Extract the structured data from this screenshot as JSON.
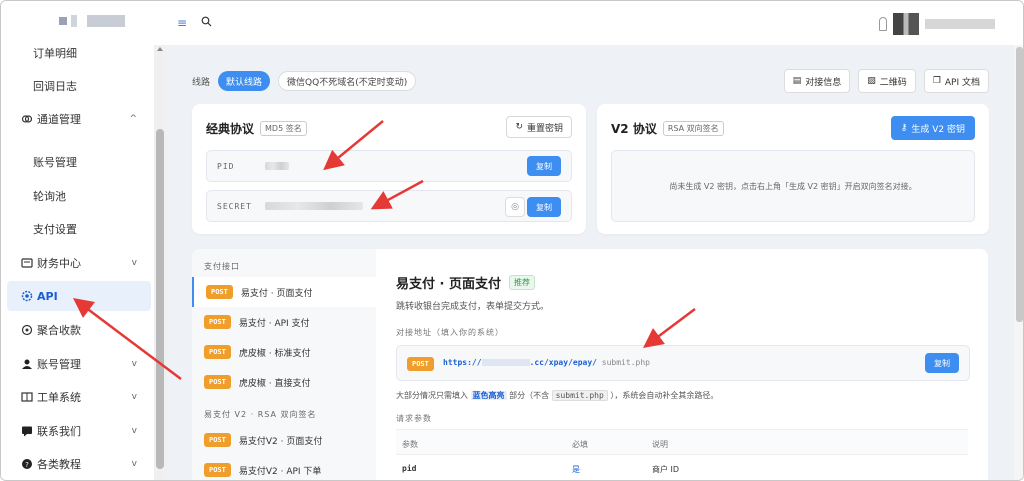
{
  "sidebar": {
    "items": [
      {
        "label": "订单明细",
        "type": "sub"
      },
      {
        "label": "回调日志",
        "type": "sub"
      },
      {
        "label": "通道管理",
        "type": "group",
        "icon": "link-icon",
        "expanded": true
      },
      {
        "label": "账号管理",
        "type": "sub"
      },
      {
        "label": "轮询池",
        "type": "sub"
      },
      {
        "label": "支付设置",
        "type": "sub"
      },
      {
        "label": "财务中心",
        "type": "group",
        "icon": "wallet-icon"
      },
      {
        "label": "API",
        "type": "group",
        "icon": "gear-icon",
        "active": true
      },
      {
        "label": "聚合收款",
        "type": "group",
        "icon": "collect-icon"
      },
      {
        "label": "账号管理",
        "type": "group",
        "icon": "user-icon"
      },
      {
        "label": "工单系统",
        "type": "group",
        "icon": "book-icon"
      },
      {
        "label": "联系我们",
        "type": "group",
        "icon": "chat-icon"
      },
      {
        "label": "各类教程",
        "type": "group",
        "icon": "help-icon"
      }
    ]
  },
  "route": {
    "label": "线路",
    "options": [
      "默认线路",
      "微信QQ不死域名(不定时变动)"
    ]
  },
  "top_actions": [
    "对接信息",
    "二维码",
    "API 文档"
  ],
  "classic": {
    "title": "经典协议",
    "tag": "MD5 签名",
    "reset_label": "重置密钥",
    "pid_label": "PID",
    "secret_label": "SECRET",
    "copy_label": "复制"
  },
  "v2": {
    "title": "V2 协议",
    "tag": "RSA 双向签名",
    "gen_label": "生成 V2 密钥",
    "empty_text": "尚未生成 V2 密钥，点击右上角「生成 V2 密钥」开启双向签名对接。"
  },
  "api_list": {
    "section1": "支付接口",
    "section2": "易支付 V2 · RSA 双向签名",
    "method": "POST",
    "items": [
      "易支付 · 页面支付",
      "易支付 · API 支付",
      "虎皮椒 · 标准支付",
      "虎皮椒 · 直接支付"
    ],
    "items_v2": [
      "易支付V2 · 页面支付",
      "易支付V2 · API 下单"
    ]
  },
  "detail": {
    "title": "易支付 · 页面支付",
    "badge": "推荐",
    "desc": "跳转收银台完成支付，表单提交方式。",
    "addr_label": "对接地址（填入你的系统）",
    "method": "POST",
    "url_prefix": "https://",
    "url_host": ".cc/xpay/epay/",
    "url_path": "submit.php",
    "copy_label": "复制",
    "note_a": "大部分情况只需填入",
    "note_hl": "蓝色高亮",
    "note_b": "部分（不含",
    "note_code": "submit.php",
    "note_c": "），系统会自动补全其余路径。",
    "req_label": "请求参数",
    "table": {
      "headers": [
        "参数",
        "必填",
        "说明"
      ],
      "rows": [
        [
          "pid",
          "是",
          "商户 ID"
        ]
      ]
    }
  },
  "colors": {
    "accent": "#3d8ef0",
    "arrow": "#e53935",
    "post": "#ef9d2b"
  }
}
